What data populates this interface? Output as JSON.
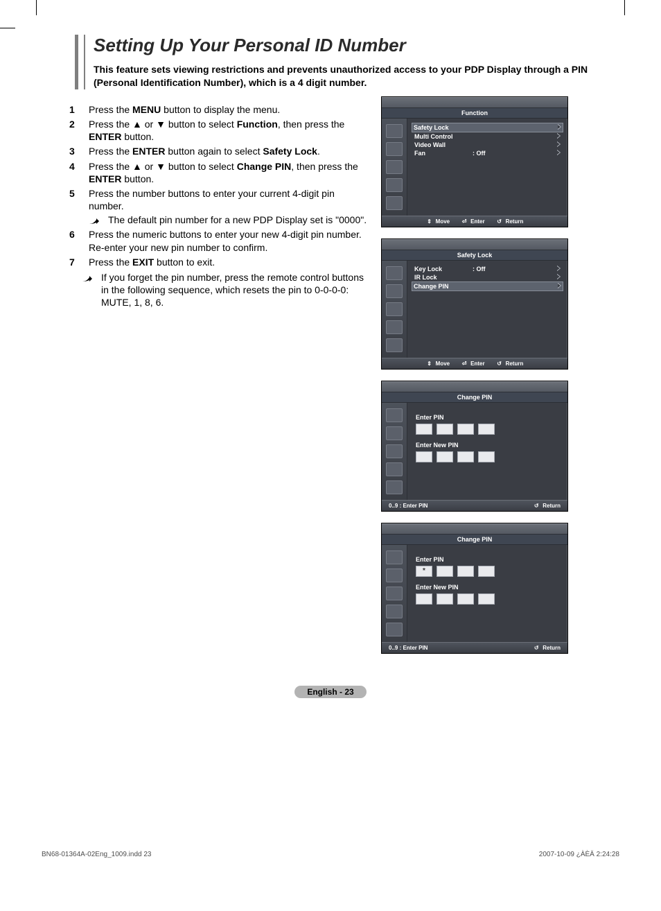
{
  "title": "Setting Up Your Personal ID Number",
  "blurb": "This feature sets viewing restrictions and prevents unauthorized access to your PDP Display through a PIN (Personal Identification Number), which is a 4 digit number.",
  "steps": {
    "s1_a": "Press the ",
    "s1_b": "MENU",
    "s1_c": " button to display the menu.",
    "s2_a": "Press the ▲ or ▼ button to select ",
    "s2_b": "Function",
    "s2_c": ", then press the ",
    "s2_d": "ENTER",
    "s2_e": " button.",
    "s3_a": "Press the ",
    "s3_b": "ENTER",
    "s3_c": " button again to select ",
    "s3_d": "Safety Lock",
    "s3_e": ".",
    "s4_a": "Press the ▲ or ▼ button to select ",
    "s4_b": "Change PIN",
    "s4_c": ", then press the ",
    "s4_d": "ENTER",
    "s4_e": " button.",
    "s5": "Press the number buttons to enter your current 4-digit pin number.",
    "s5_note": "The default pin number for a new PDP Display set is \"0000\".",
    "s6": "Press the numeric buttons to enter your new 4-digit pin number. Re-enter your new pin number to confirm.",
    "s7_a": "Press the ",
    "s7_b": "EXIT",
    "s7_c": " button to exit.",
    "tail_note": "If you forget the pin number, press the remote control buttons in the following sequence, which resets the pin to 0-0-0-0: MUTE, 1, 8, 6."
  },
  "osd": {
    "function": {
      "header": "Function",
      "items": [
        {
          "label": "Safety Lock",
          "value": "",
          "arrow": true,
          "selected": true
        },
        {
          "label": "Multi Control",
          "value": "",
          "arrow": true
        },
        {
          "label": "Video Wall",
          "value": "",
          "arrow": true
        },
        {
          "label": "Fan",
          "value": ": Off",
          "arrow": true
        }
      ],
      "footer": {
        "move": "Move",
        "enter": "Enter",
        "return": "Return"
      }
    },
    "safety": {
      "header": "Safety Lock",
      "items": [
        {
          "label": "Key Lock",
          "value": ": Off",
          "arrow": true
        },
        {
          "label": "IR Lock",
          "value": "",
          "arrow": true
        },
        {
          "label": "Change PIN",
          "value": "",
          "arrow": true,
          "selected": true
        }
      ],
      "footer": {
        "move": "Move",
        "enter": "Enter",
        "return": "Return"
      }
    },
    "change1": {
      "header": "Change PIN",
      "enter_pin": "Enter PIN",
      "enter_new_pin": "Enter New PIN",
      "footer_left": "0..9 : Enter PIN",
      "footer_right": "Return",
      "star": ""
    },
    "change2": {
      "header": "Change PIN",
      "enter_pin": "Enter PIN",
      "enter_new_pin": "Enter New PIN",
      "footer_left": "0..9 : Enter PIN",
      "footer_right": "Return",
      "star": "*"
    }
  },
  "footer": {
    "page": "English - 23",
    "indd": "BN68-01364A-02Eng_1009.indd   23",
    "ts": "2007-10-09   ¿ÀÈÄ 2:24:28"
  }
}
